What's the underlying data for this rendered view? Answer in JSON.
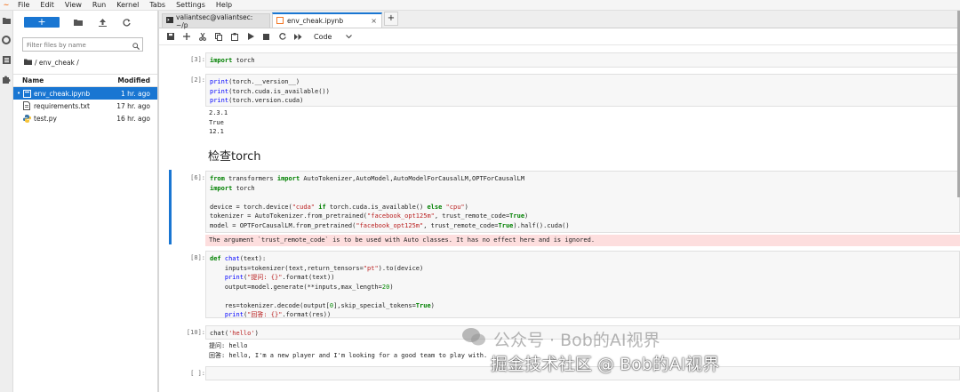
{
  "menubar": {
    "items": [
      "File",
      "Edit",
      "View",
      "Run",
      "Kernel",
      "Tabs",
      "Settings",
      "Help"
    ]
  },
  "filebrowser": {
    "new_label": "+",
    "filter_placeholder": "Filter files by name",
    "breadcrumb": "/ env_cheak /",
    "col_name": "Name",
    "col_modified": "Modified",
    "files": [
      {
        "name": "env_cheak.ipynb",
        "modified": "1 hr. ago",
        "icon": "notebook-icon",
        "selected": true
      },
      {
        "name": "requirements.txt",
        "modified": "17 hr. ago",
        "icon": "text-file-icon",
        "selected": false
      },
      {
        "name": "test.py",
        "modified": "16 hr. ago",
        "icon": "python-icon",
        "selected": false
      }
    ]
  },
  "tabs": [
    {
      "label": "valiantsec@valiantsec: ~/p",
      "active": false
    },
    {
      "label": "env_cheak.ipynb",
      "active": true
    }
  ],
  "toolbar": {
    "cell_type": "Code"
  },
  "cells": {
    "c1": {
      "prompt": "[3]:",
      "code": "import torch"
    },
    "c2": {
      "prompt": "[2]:",
      "code_lines": [
        "print(torch.__version__)",
        "print(torch.cuda.is_available())",
        "print(torch.version.cuda)"
      ],
      "output": "2.3.1\nTrue\n12.1"
    },
    "md": {
      "heading": "检查torch"
    },
    "c3": {
      "prompt": "[6]:",
      "code_lines": [
        "from transformers import AutoTokenizer,AutoModel,AutoModelForCausalLM,OPTForCausalLM",
        "import torch",
        "",
        "device = torch.device(\"cuda\" if torch.cuda.is_available() else \"cpu\")",
        "tokenizer = AutoTokenizer.from_pretrained(\"facebook_opt125m\", trust_remote_code=True)",
        "model = OPTForCausalLM.from_pretrained(\"facebook_opt125m\", trust_remote_code=True).half().cuda()"
      ],
      "stderr": "The argument `trust_remote_code` is to be used with Auto classes. It has no effect here and is ignored."
    },
    "c4": {
      "prompt": "[8]:",
      "code_lines": [
        "def chat(text):",
        "    inputs=tokenizer(text,return_tensors=\"pt\").to(device)",
        "    print(\"提问: {}\".format(text))",
        "    output=model.generate(**inputs,max_length=20)",
        "",
        "    res=tokenizer.decode(output[0],skip_special_tokens=True)",
        "    print(\"回答: {}\".format(res))"
      ]
    },
    "c5": {
      "prompt": "[10]:",
      "code": "chat('hello')",
      "output": "提问: hello\n回答: hello, I'm a new player and I'm looking for a good team to play with."
    },
    "c6": {
      "prompt": "[ ]:",
      "code": ""
    }
  },
  "watermark": {
    "line1": "公众号 · Bob的AI视界",
    "line2": "掘金技术社区 @ Bob的AI视界"
  }
}
